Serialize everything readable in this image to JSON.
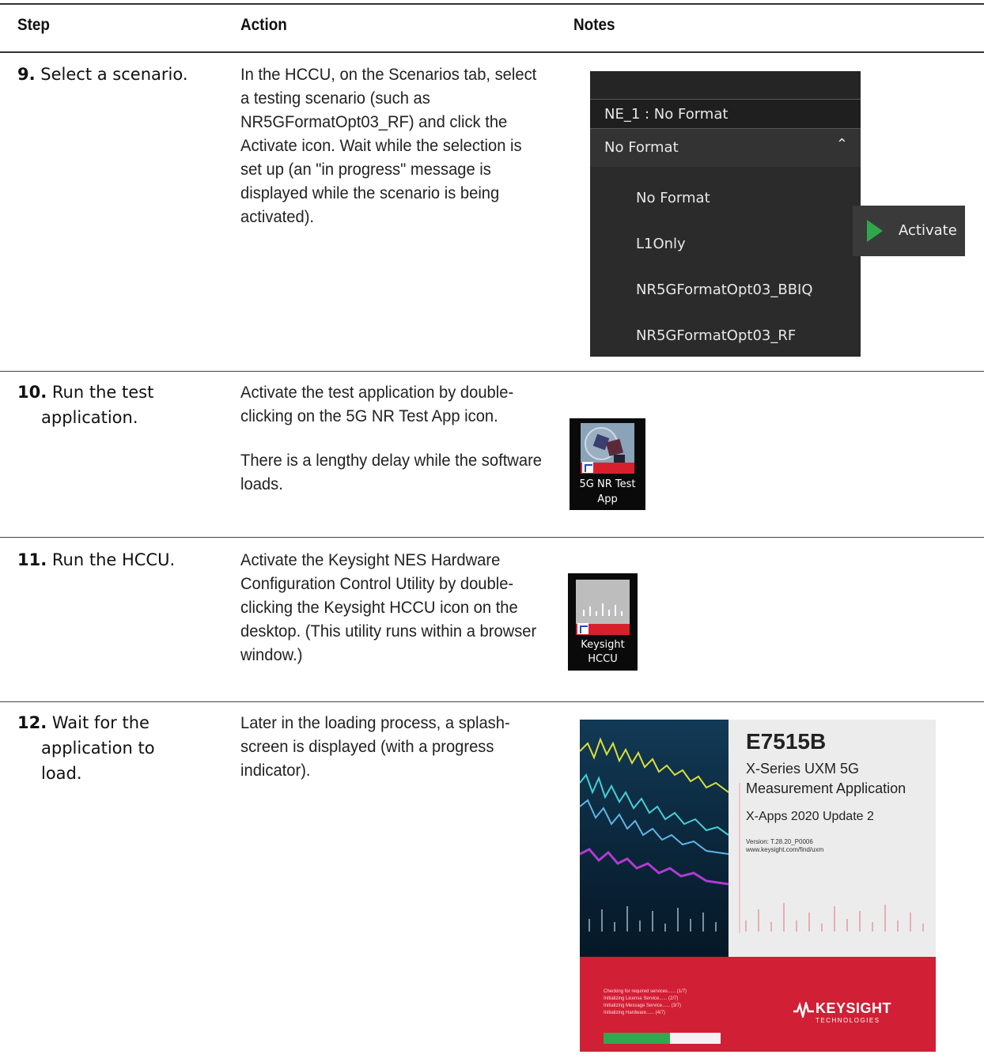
{
  "table": {
    "headers": {
      "step": "Step",
      "action": "Action",
      "notes": "Notes"
    },
    "rows": [
      {
        "step_num": "9.",
        "step_lines": [
          "Select a scenario."
        ],
        "action": [
          "In the HCCU, on the Scenarios tab, select a testing scenario (such as NR5GFormatOpt03_RF) and click the Activate icon. Wait while the selection is set up (an \"in progress\" message is displayed while the scenario is being activated)."
        ]
      },
      {
        "step_num": "10.",
        "step_lines": [
          "Run the test",
          "application."
        ],
        "action": [
          "Activate the test application by double-clicking on the 5G NR Test App icon.",
          "There is a lengthy delay while the software loads."
        ]
      },
      {
        "step_num": "11.",
        "step_lines": [
          "Run the HCCU."
        ],
        "action": [
          "Activate the Keysight NES Hardware Configuration Control Utility by double-clicking the Keysight HCCU icon on the desktop. (This utility runs within a browser window.)"
        ]
      },
      {
        "step_num": "12.",
        "step_lines": [
          "Wait for the",
          "application to",
          "load."
        ],
        "action": [
          "Later in the loading process, a splash-screen is displayed (with a progress indicator)."
        ]
      }
    ]
  },
  "scenario_dropdown": {
    "header": "NE_1 : No Format",
    "selected": "No Format",
    "chevron": "chevron-up-icon",
    "options": [
      "No Format",
      "L1Only",
      "NR5GFormatOpt03_BBIQ",
      "NR5GFormatOpt03_RF"
    ],
    "activate_label": "Activate",
    "activate_color": "#2ea84a"
  },
  "icons": {
    "test_app": {
      "label_1": "5G NR Test",
      "label_2": "App"
    },
    "hccu": {
      "label_1": "Keysight",
      "label_2": "HCCU"
    }
  },
  "splash": {
    "model": "E7515B",
    "line1": "X-Series UXM 5G",
    "line2": "Measurement Application",
    "update": "X-Apps 2020 Update 2",
    "version": "Version: T.28.20_P0006",
    "url": "www.keysight.com/find/uxm",
    "status": [
      "Checking for required services...... (1/7)",
      "Initializing License Service...... (2/7)",
      "Initializing Message Service...... (3/7)",
      "Initializing Hardware...... (4/7)"
    ],
    "progress": 0.57,
    "brand": "KEYSIGHT",
    "brand_sub": "TECHNOLOGIES",
    "brand_color": "#d11f35"
  }
}
